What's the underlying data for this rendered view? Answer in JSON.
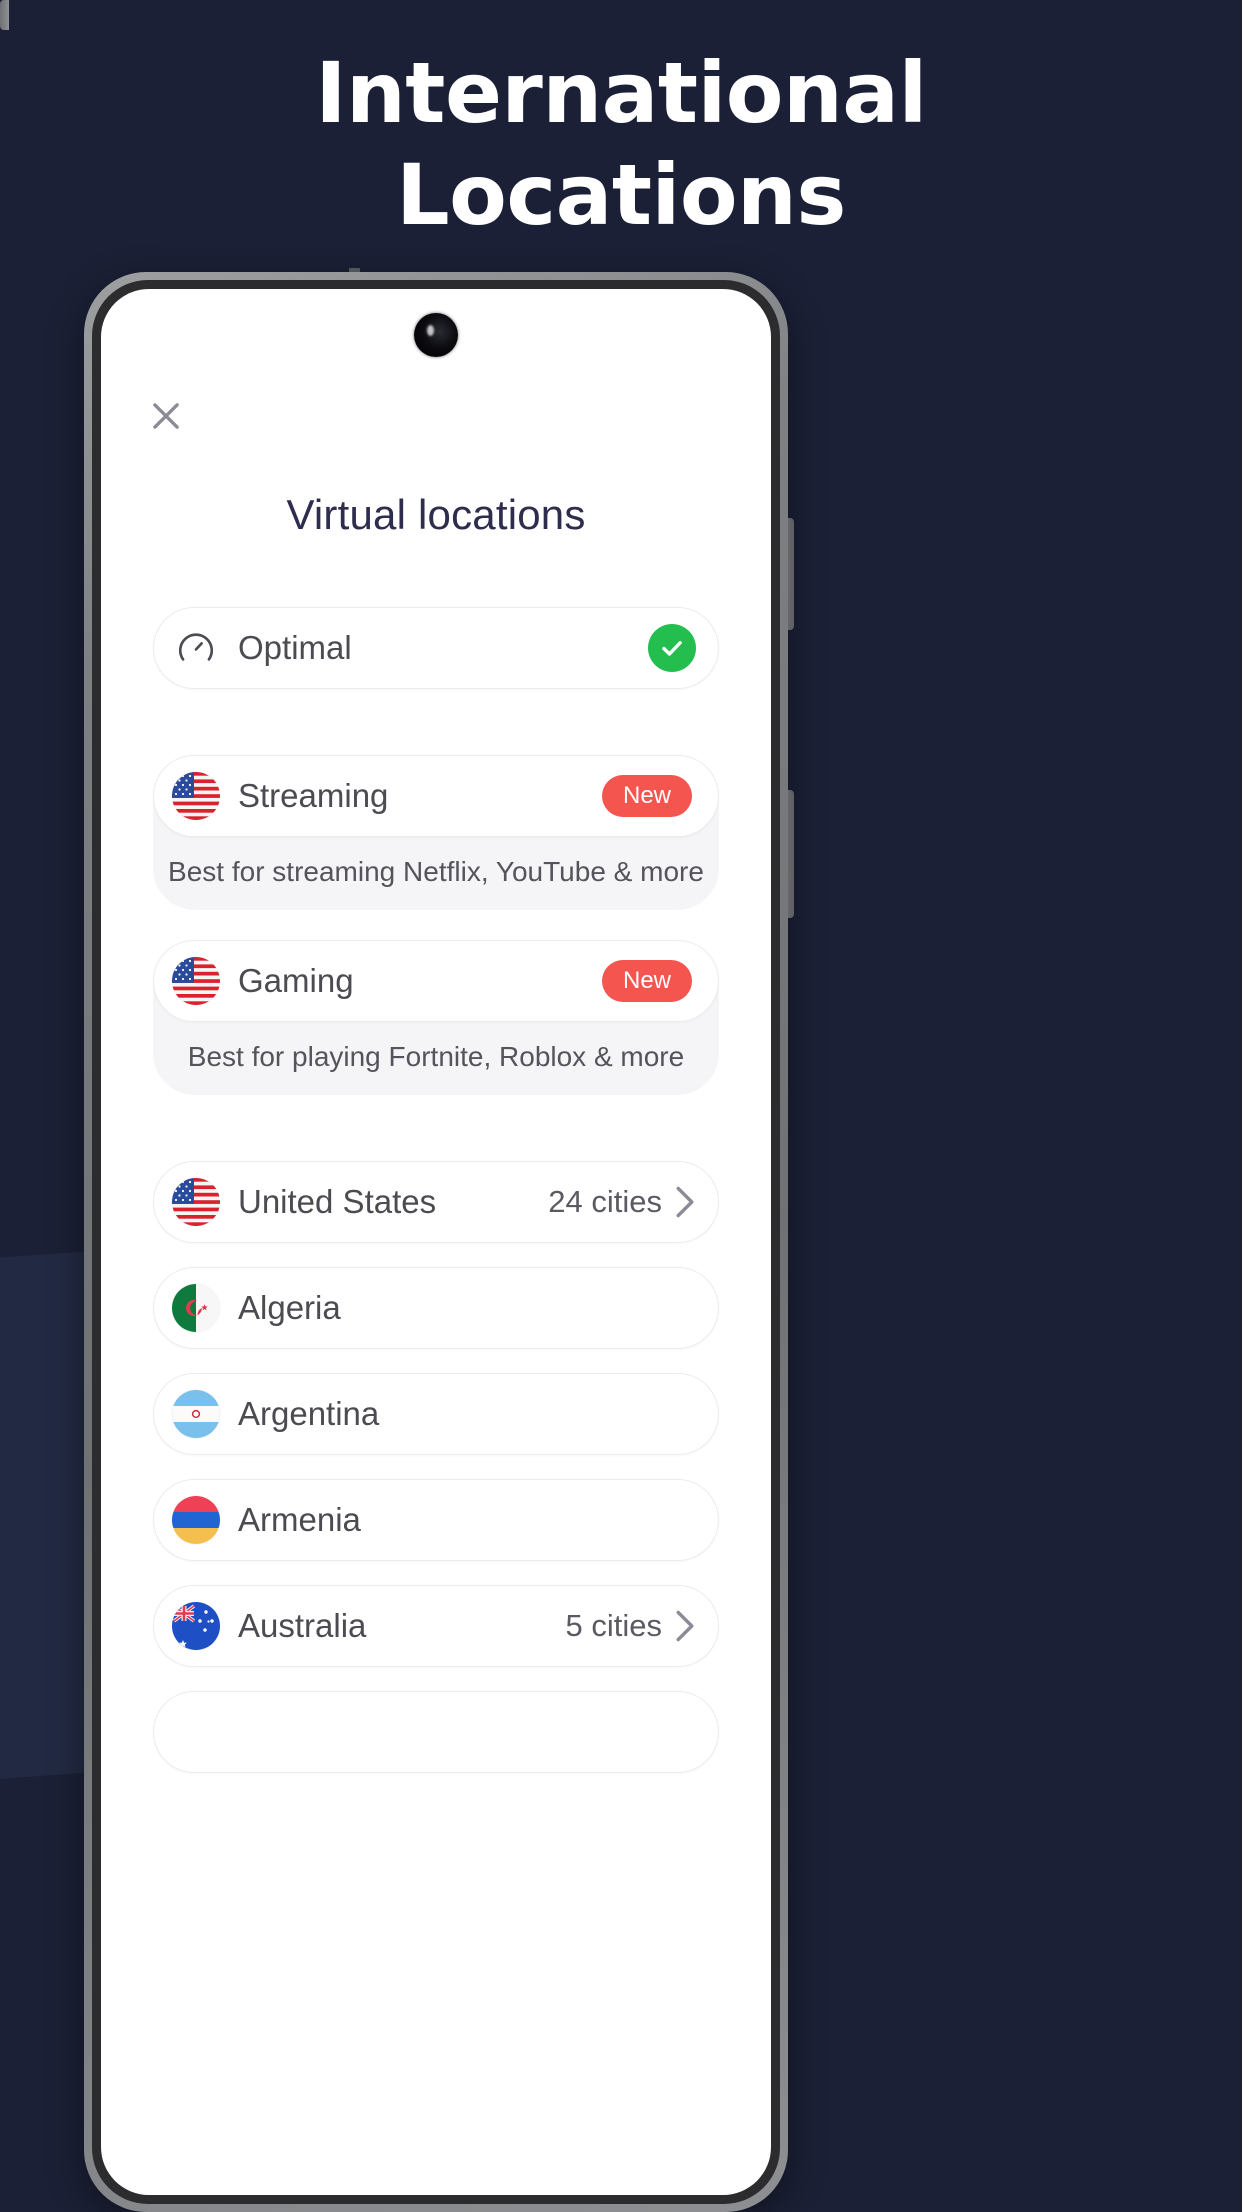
{
  "headline": {
    "line1": "International",
    "line2": "Locations"
  },
  "colors": {
    "background": "#1b2036",
    "title_text": "#ffffff",
    "page_title": "#2e2d4e",
    "badge_new": "#f4564f",
    "check_green": "#24be4f",
    "card_gray": "#f5f5f7",
    "row_border": "#ececed",
    "label_text": "#4b4b52"
  },
  "screen": {
    "close_icon": "close-icon",
    "title": "Virtual locations"
  },
  "optimal": {
    "icon": "speedometer-icon",
    "label": "Optimal",
    "selected_icon": "check-circle-icon"
  },
  "features": [
    {
      "flag": "us-flag",
      "label": "Streaming",
      "badge": "New",
      "subtitle": "Best for streaming Netflix, YouTube & more"
    },
    {
      "flag": "us-flag",
      "label": "Gaming",
      "badge": "New",
      "subtitle": "Best for playing Fortnite, Roblox & more"
    }
  ],
  "countries": [
    {
      "flag": "us-flag",
      "label": "United States",
      "meta": "24 cities",
      "chevron": true
    },
    {
      "flag": "algeria-flag",
      "label": "Algeria",
      "meta": "",
      "chevron": false
    },
    {
      "flag": "argentina-flag",
      "label": "Argentina",
      "meta": "",
      "chevron": false
    },
    {
      "flag": "armenia-flag",
      "label": "Armenia",
      "meta": "",
      "chevron": false
    },
    {
      "flag": "australia-flag",
      "label": "Australia",
      "meta": "5 cities",
      "chevron": true
    }
  ]
}
